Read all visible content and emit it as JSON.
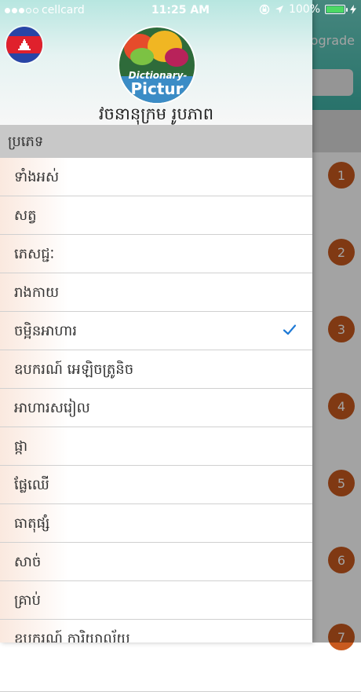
{
  "status_bar": {
    "carrier": "cellcard",
    "time": "11:25 AM",
    "battery": "100%",
    "battery_level": 1.0
  },
  "background": {
    "upgrade_label": "ograde",
    "badges": [
      "1",
      "2",
      "3",
      "4",
      "5",
      "6",
      "7"
    ]
  },
  "drawer": {
    "logo_text_1": "Dictionary-",
    "logo_text_2": "Pictur",
    "title": "វចនានុក្រម រូបភាព",
    "section_label": "ប្រភេទ",
    "items": [
      {
        "label": "ទាំងអស់"
      },
      {
        "label": "សត្វ"
      },
      {
        "label": "ភេសជ្ជៈ"
      },
      {
        "label": "រាងកាយ"
      },
      {
        "label": "ចម្អិនអាហារ",
        "selected": true
      },
      {
        "label": "ឧបករណ៍ អេឡិចត្រូនិច"
      },
      {
        "label": "អាហារសរៀល"
      },
      {
        "label": "ផ្កា"
      },
      {
        "label": "ផ្លែឈើ"
      },
      {
        "label": "ធាតុផ្សំ"
      },
      {
        "label": "សាច់"
      },
      {
        "label": "គ្រាប់"
      },
      {
        "label": "ឧបករណ៍ ការិយាល័យ"
      }
    ]
  },
  "colors": {
    "badge": "#c95a1f",
    "check": "#1f7ad6",
    "section_bg": "#c8c8c8"
  },
  "icons": {
    "flag": "cambodia-flag-icon",
    "check": "checkmark-icon",
    "location": "location-arrow-icon",
    "lock": "rotation-lock-icon"
  }
}
